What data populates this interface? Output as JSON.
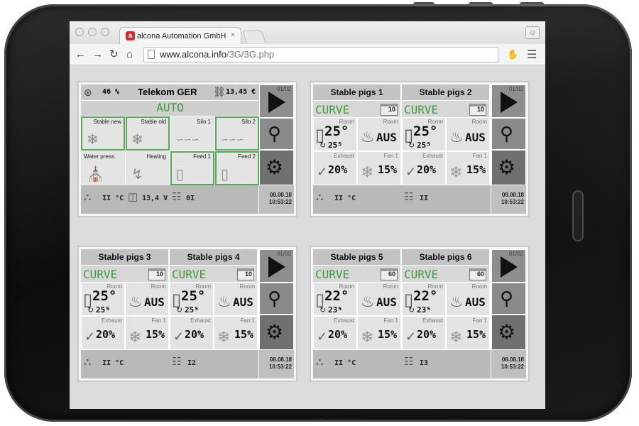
{
  "browser": {
    "tab_title": "alcona Automation GmbH",
    "tab_logo": "a",
    "tab_close": "×",
    "url_domain": "www.alcona.info",
    "url_path": "/3G/3G.php"
  },
  "overview": {
    "signal": "46 %",
    "provider": "Telekom GER",
    "credit": "13,45 €",
    "mode": "AUTO",
    "cells": [
      "Stable new",
      "Stable old",
      "Silo 1",
      "Silo 2",
      "Water press.",
      "Heating",
      "Feed 1",
      "Feed 2"
    ],
    "footer_temp": "II °C",
    "footer_voltage": "13,4 V",
    "footer_count": "0I",
    "page": "01/02",
    "date": "08.08.18",
    "time": "10:53:22"
  },
  "panels": [
    {
      "footer_temp": "II °C",
      "footer_count": "II",
      "page": "01/02",
      "date": "08.08.18",
      "time": "10:53:22",
      "rooms": [
        {
          "title": "Stable pigs 1",
          "mode": "CURVE",
          "cal": "10",
          "room_label": "Room",
          "temp": "25°",
          "temp_sub": "25",
          "temp_sub_unit": "s",
          "heat_label": "Room",
          "heat": "AUS",
          "exhaust_label": "Exhaust",
          "exhaust": "20%",
          "fan_label": "Fan 1",
          "fan": "15%"
        },
        {
          "title": "Stable pigs 2",
          "mode": "CURVE",
          "cal": "10",
          "room_label": "Room",
          "temp": "25°",
          "temp_sub": "25",
          "temp_sub_unit": "s",
          "heat_label": "Room",
          "heat": "AUS",
          "exhaust_label": "Exhaust",
          "exhaust": "20%",
          "fan_label": "Fan 1",
          "fan": "15%"
        }
      ]
    },
    {
      "footer_temp": "II °C",
      "footer_count": "I2",
      "page": "01/02",
      "date": "08.08.18",
      "time": "10:53:22",
      "rooms": [
        {
          "title": "Stable pigs 3",
          "mode": "CURVE",
          "cal": "10",
          "room_label": "Room",
          "temp": "25°",
          "temp_sub": "25",
          "temp_sub_unit": "s",
          "heat_label": "Room",
          "heat": "AUS",
          "exhaust_label": "Exhaust",
          "exhaust": "20%",
          "fan_label": "Fan 1",
          "fan": "15%"
        },
        {
          "title": "Stable pigs 4",
          "mode": "CURVE",
          "cal": "10",
          "room_label": "Room",
          "temp": "25°",
          "temp_sub": "25",
          "temp_sub_unit": "s",
          "heat_label": "Room",
          "heat": "AUS",
          "exhaust_label": "Exhaust",
          "exhaust": "20%",
          "fan_label": "Fan 1",
          "fan": "15%"
        }
      ]
    },
    {
      "footer_temp": "II °C",
      "footer_count": "I3",
      "page": "01/02",
      "date": "08.08.18",
      "time": "10:53:22",
      "rooms": [
        {
          "title": "Stable pigs 5",
          "mode": "CURVE",
          "cal": "60",
          "room_label": "Room",
          "temp": "22°",
          "temp_sub": "23",
          "temp_sub_unit": "s",
          "heat_label": "Room",
          "heat": "AUS",
          "exhaust_label": "Exhaust",
          "exhaust": "20%",
          "fan_label": "Fan 1",
          "fan": "15%"
        },
        {
          "title": "Stable pigs 6",
          "mode": "CURVE",
          "cal": "60",
          "room_label": "Room",
          "temp": "22°",
          "temp_sub": "23",
          "temp_sub_unit": "s",
          "heat_label": "Room",
          "heat": "AUS",
          "exhaust_label": "Exhaust",
          "exhaust": "20%",
          "fan_label": "Fan 1",
          "fan": "15%"
        }
      ]
    }
  ],
  "icons": {
    "play": "play-icon",
    "zoom": "magnifier-icon",
    "gear": "gears-icon",
    "thermometer": "thermometer-icon",
    "flame": "flame-icon",
    "fan": "fan-icon",
    "valve": "valve-icon",
    "silo": "silo-icon",
    "tap": "tap-icon",
    "bolt": "bolt-icon",
    "network": "network-icon",
    "battery": "battery-icon",
    "antenna": "antenna-icon",
    "coins": "coins-icon"
  },
  "colors": {
    "mode_green": "#3c9d3c",
    "ok_border": "#5aa85a"
  }
}
